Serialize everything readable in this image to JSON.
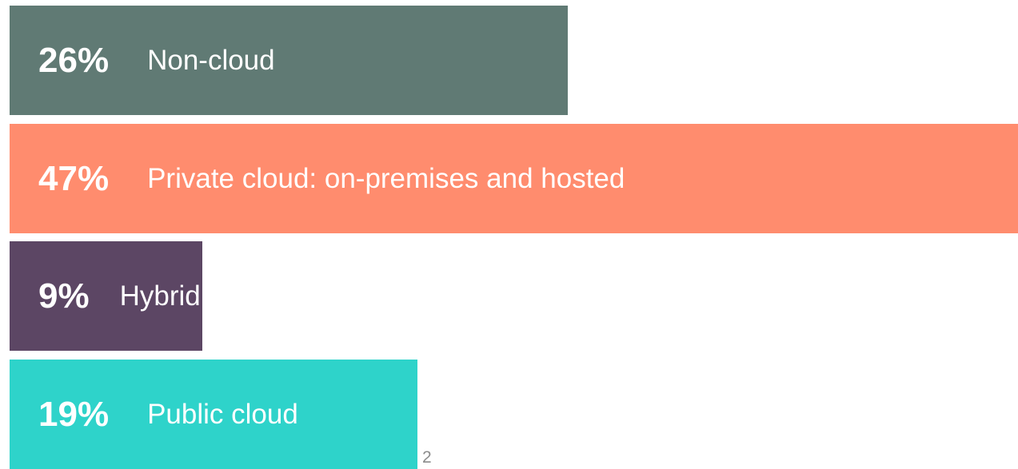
{
  "slide": {
    "page_number": "2"
  },
  "chart_data": {
    "type": "bar",
    "orientation": "horizontal",
    "categories": [
      "Non-cloud",
      "Private cloud: on-premises and hosted",
      "Hybrid",
      "Public cloud"
    ],
    "values": [
      26,
      47,
      9,
      19
    ],
    "value_labels": [
      "26%",
      "47%",
      "9%",
      "19%"
    ],
    "unit": "%",
    "xlim": [
      0,
      47
    ],
    "grid": false,
    "legend": "none",
    "colors": [
      "#607a74",
      "#ff8c6e",
      "#5c4664",
      "#2ed3ca"
    ],
    "text_color": "#ffffff"
  }
}
